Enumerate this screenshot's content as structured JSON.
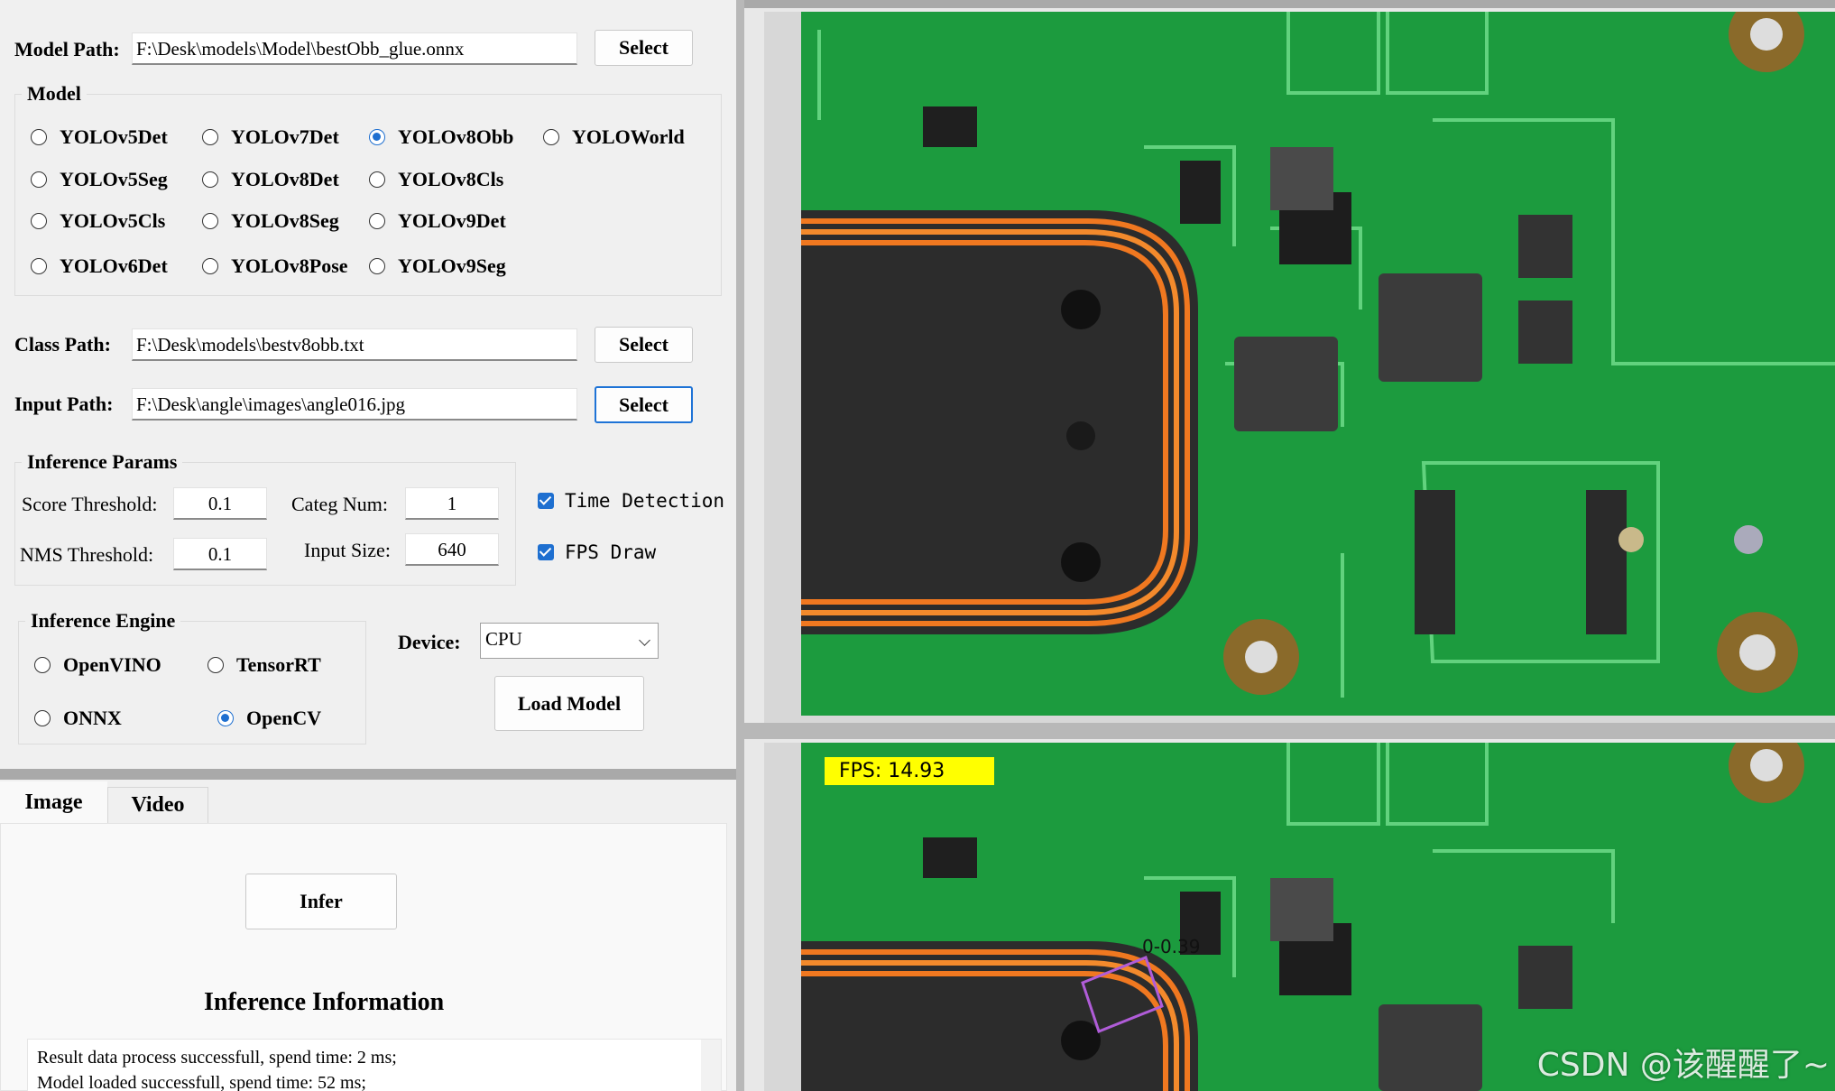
{
  "model_path": {
    "label": "Model Path:",
    "value": "F:\\Desk\\models\\Model\\bestObb_glue.onnx",
    "button": "Select"
  },
  "model_group": {
    "title": "Model",
    "options": [
      {
        "label": "YOLOv5Det",
        "checked": false
      },
      {
        "label": "YOLOv7Det",
        "checked": false
      },
      {
        "label": "YOLOv8Obb",
        "checked": true
      },
      {
        "label": "YOLOWorld",
        "checked": false
      },
      {
        "label": "YOLOv5Seg",
        "checked": false
      },
      {
        "label": "YOLOv8Det",
        "checked": false
      },
      {
        "label": "YOLOv8Cls",
        "checked": false
      },
      {
        "label": "YOLOv5Cls",
        "checked": false
      },
      {
        "label": "YOLOv8Seg",
        "checked": false
      },
      {
        "label": "YOLOv9Det",
        "checked": false
      },
      {
        "label": "YOLOv6Det",
        "checked": false
      },
      {
        "label": "YOLOv8Pose",
        "checked": false
      },
      {
        "label": "YOLOv9Seg",
        "checked": false
      }
    ]
  },
  "class_path": {
    "label": "Class Path:",
    "value": "F:\\Desk\\models\\bestv8obb.txt",
    "button": "Select"
  },
  "input_path": {
    "label": "Input Path:",
    "value": "F:\\Desk\\angle\\images\\angle016.jpg",
    "button": "Select"
  },
  "params": {
    "title": "Inference Params",
    "score_label": "Score Threshold:",
    "score_value": "0.1",
    "categ_label": "Categ Num:",
    "categ_value": "1",
    "nms_label": "NMS Threshold:",
    "nms_value": "0.1",
    "size_label": "Input Size:",
    "size_value": "640",
    "time_detection": "Time Detection",
    "fps_draw": "FPS Draw"
  },
  "engine": {
    "title": "Inference Engine",
    "options": [
      {
        "label": "OpenVINO",
        "checked": false
      },
      {
        "label": "TensorRT",
        "checked": false
      },
      {
        "label": "ONNX",
        "checked": false
      },
      {
        "label": "OpenCV",
        "checked": true
      }
    ]
  },
  "device": {
    "label": "Device:",
    "value": "CPU"
  },
  "load_button": "Load Model",
  "tabs": [
    {
      "label": "Image"
    },
    {
      "label": "Video"
    }
  ],
  "infer_button": "Infer",
  "info": {
    "title": "Inference Information",
    "lines": [
      "Result data process successfull, spend time: 2 ms;",
      "Model loaded successfull, spend time: 52 ms;"
    ]
  },
  "result": {
    "fps_text": "FPS: 14.93",
    "detection_label": "0-0.39"
  },
  "watermark": "CSDN @该醒醒了~",
  "colors": {
    "accent": "#1e6fd0",
    "pcb_green": "#1c9b3e",
    "trace_orange": "#f07820",
    "fps_bg": "#ffff00",
    "obb_box": "#b05cd8"
  }
}
